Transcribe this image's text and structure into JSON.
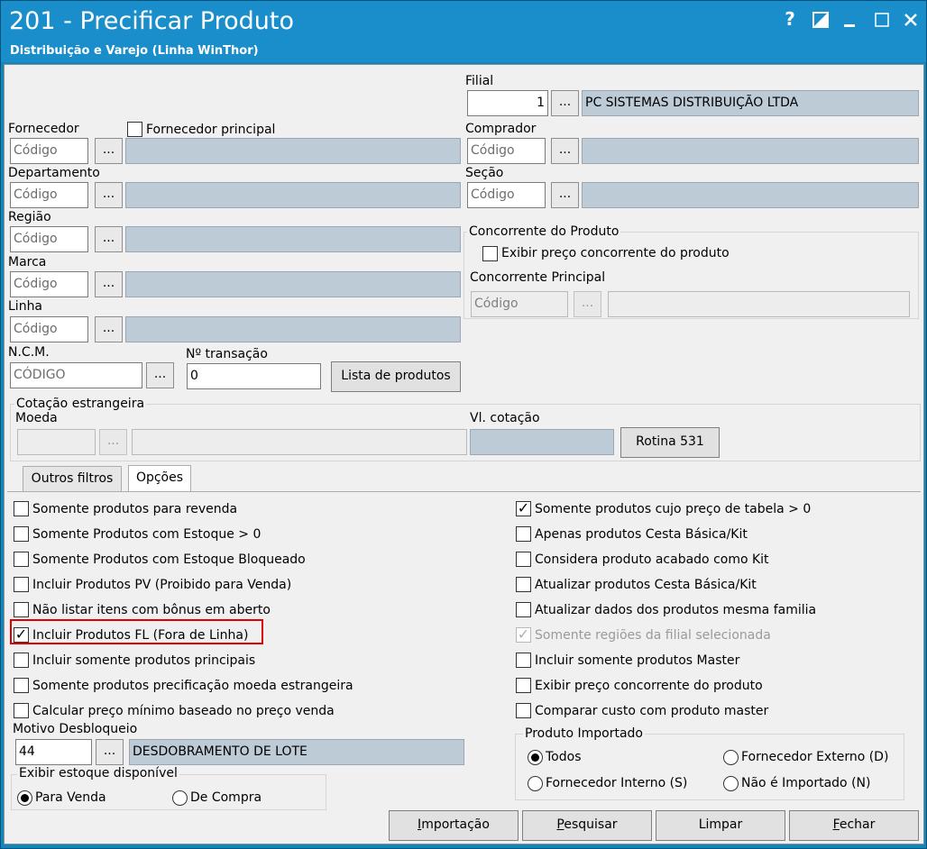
{
  "window": {
    "title": "201 - Precificar Produto",
    "subtitle": "Distribuição e Varejo (Linha WinThor)",
    "controls": {
      "help": "?",
      "restore": "◪",
      "minimize": "_",
      "maximize": "☐",
      "close": "✕"
    }
  },
  "filters": {
    "filial": {
      "label": "Filial",
      "code": "1",
      "name": "PC SISTEMAS DISTRIBUIÇÃO LTDA"
    },
    "fornecedor": {
      "label": "Fornecedor",
      "placeholder": "Código",
      "principal_label": "Fornecedor principal"
    },
    "comprador": {
      "label": "Comprador",
      "placeholder": "Código"
    },
    "departamento": {
      "label": "Departamento",
      "placeholder": "Código"
    },
    "secao": {
      "label": "Seção",
      "placeholder": "Código"
    },
    "regiao": {
      "label": "Região",
      "placeholder": "Código"
    },
    "marca": {
      "label": "Marca",
      "placeholder": "Código"
    },
    "linha": {
      "label": "Linha",
      "placeholder": "Código"
    },
    "ncm": {
      "label": "N.C.M.",
      "placeholder": "CÓDIGO"
    },
    "transacao": {
      "label": "Nº transação",
      "value": "0"
    },
    "lista_produtos": "Lista de produtos",
    "dots": "..."
  },
  "concorrente": {
    "group_title": "Concorrente do Produto",
    "exibir_label": "Exibir preço concorrente do produto",
    "principal_label": "Concorrente Principal",
    "placeholder": "Código"
  },
  "cotacao": {
    "group_title": "Cotação estrangeira",
    "moeda_label": "Moeda",
    "vl_label": "Vl. cotação",
    "rotina_button": "Rotina 531"
  },
  "tabs": [
    {
      "label": "Outros filtros"
    },
    {
      "label": "Opções"
    }
  ],
  "options_left": [
    {
      "label": "Somente produtos para revenda",
      "checked": false
    },
    {
      "label": "Somente Produtos com Estoque > 0",
      "checked": false
    },
    {
      "label": "Somente Produtos com Estoque Bloqueado",
      "checked": false
    },
    {
      "label": "Incluir Produtos PV (Proibido para Venda)",
      "checked": false
    },
    {
      "label": "Não listar itens com bônus em aberto",
      "checked": false
    },
    {
      "label": "Incluir Produtos FL (Fora de Linha)",
      "checked": true
    },
    {
      "label": "Incluir somente produtos principais",
      "checked": false
    },
    {
      "label": "Somente produtos precificação moeda estrangeira",
      "checked": false
    },
    {
      "label": "Calcular preço mínimo baseado no preço venda",
      "checked": false
    }
  ],
  "options_right": [
    {
      "label": "Somente produtos cujo preço de tabela > 0",
      "checked": true
    },
    {
      "label": "Apenas produtos Cesta Básica/Kit",
      "checked": false
    },
    {
      "label": "Considera produto acabado como Kit",
      "checked": false
    },
    {
      "label": "Atualizar produtos Cesta Básica/Kit",
      "checked": false
    },
    {
      "label": "Atualizar dados dos produtos mesma familia",
      "checked": false
    },
    {
      "label": "Somente regiões da filial selecionada",
      "checked": true
    },
    {
      "label": "Incluir somente produtos Master",
      "checked": false
    },
    {
      "label": "Exibir preço concorrente do produto",
      "checked": false
    },
    {
      "label": "Comparar custo com produto master",
      "checked": false
    }
  ],
  "motivo": {
    "label": "Motivo Desbloqueio",
    "code": "44",
    "name": "DESDOBRAMENTO DE LOTE"
  },
  "estoque": {
    "group_title": "Exibir estoque disponível",
    "para_venda": "Para Venda",
    "de_compra": "De Compra"
  },
  "importado": {
    "group_title": "Produto Importado",
    "todos": "Todos",
    "fornecedor_externo": "Fornecedor Externo (D)",
    "fornecedor_interno": "Fornecedor Interno (S)",
    "nao_importado": "Não é Importado (N)"
  },
  "actions": {
    "importacao": "Importação",
    "pesquisar": "Pesquisar",
    "limpar": "Limpar",
    "fechar": "Fechar"
  },
  "colors": {
    "title_bg": "#1a8ecb",
    "readonly_bg": "#bdcbd7",
    "highlight": "#e00000"
  }
}
